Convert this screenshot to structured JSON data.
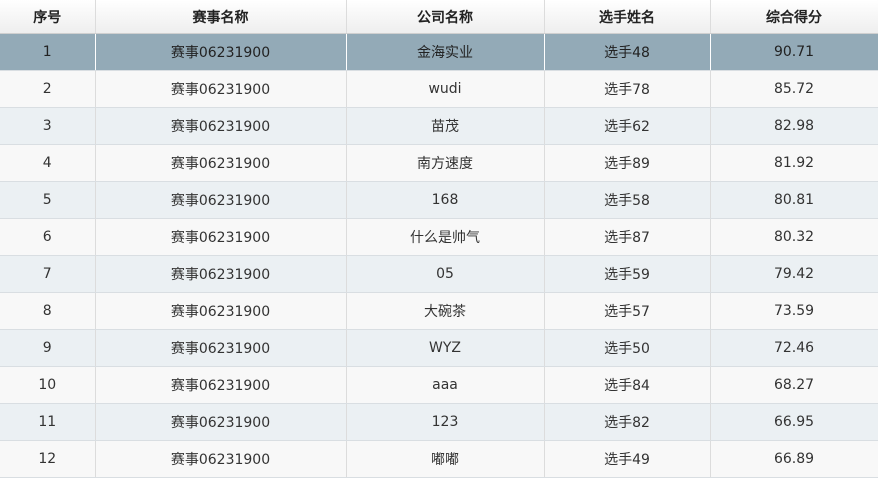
{
  "columns": [
    "序号",
    "赛事名称",
    "公司名称",
    "选手姓名",
    "综合得分"
  ],
  "rows": [
    [
      "1",
      "赛事06231900",
      "金海实业",
      "选手48",
      "90.71"
    ],
    [
      "2",
      "赛事06231900",
      "wudi",
      "选手78",
      "85.72"
    ],
    [
      "3",
      "赛事06231900",
      "苗茂",
      "选手62",
      "82.98"
    ],
    [
      "4",
      "赛事06231900",
      "南方速度",
      "选手89",
      "81.92"
    ],
    [
      "5",
      "赛事06231900",
      "168",
      "选手58",
      "80.81"
    ],
    [
      "6",
      "赛事06231900",
      "什么是帅气",
      "选手87",
      "80.32"
    ],
    [
      "7",
      "赛事06231900",
      "05",
      "选手59",
      "79.42"
    ],
    [
      "8",
      "赛事06231900",
      "大碗茶",
      "选手57",
      "73.59"
    ],
    [
      "9",
      "赛事06231900",
      "WYZ",
      "选手50",
      "72.46"
    ],
    [
      "10",
      "赛事06231900",
      "aaa",
      "选手84",
      "68.27"
    ],
    [
      "11",
      "赛事06231900",
      "123",
      "选手82",
      "66.95"
    ],
    [
      "12",
      "赛事06231900",
      "嘟嘟",
      "选手49",
      "66.89"
    ]
  ],
  "selected_row": 1,
  "colors": {
    "selected_row": "#93aab7",
    "even_row": "#f8f8f8",
    "odd_row": "#ebf0f3"
  }
}
